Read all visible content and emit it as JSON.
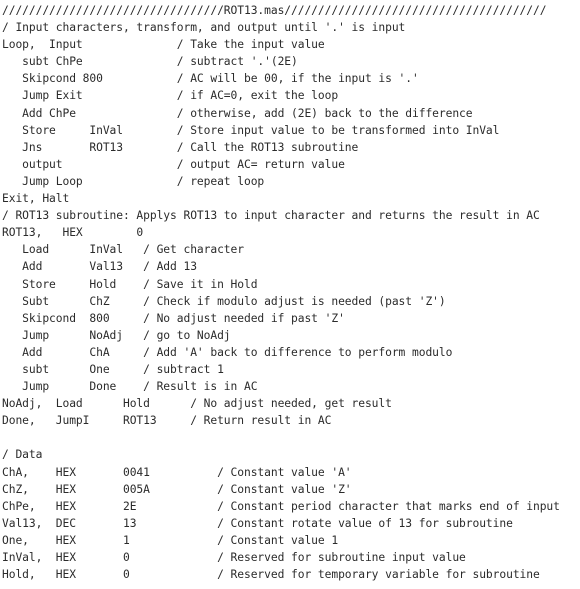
{
  "document": {
    "title": "ROT13.mas",
    "language": "MARIE Assembly",
    "background_color": "#ffffff",
    "text_color": "#2b2b2b"
  },
  "code": {
    "lines": [
      "/////////////////////////////////ROT13.mas///////////////////////////////////////",
      "/ Input characters, transform, and output until '.' is input",
      "Loop,  Input              / Take the input value",
      "   subt ChPe              / subtract '.'(2E)",
      "   Skipcond 800           / AC will be 00, if the input is '.'",
      "   Jump Exit              / if AC=0, exit the loop",
      "   Add ChPe               / otherwise, add (2E) back to the difference",
      "   Store     InVal        / Store input value to be transformed into InVal",
      "   Jns       ROT13        / Call the ROT13 subroutine",
      "   output                 / output AC= return value",
      "   Jump Loop              / repeat loop",
      "Exit, Halt",
      "/ ROT13 subroutine: Applys ROT13 to input character and returns the result in AC",
      "ROT13,   HEX        0",
      "   Load      InVal   / Get character",
      "   Add       Val13   / Add 13",
      "   Store     Hold    / Save it in Hold",
      "   Subt      ChZ     / Check if modulo adjust is needed (past 'Z')",
      "   Skipcond  800     / No adjust needed if past 'Z'",
      "   Jump      NoAdj   / go to NoAdj",
      "   Add       ChA     / Add 'A' back to difference to perform modulo",
      "   subt      One     / subtract 1",
      "   Jump      Done    / Result is in AC",
      "NoAdj,  Load      Hold      / No adjust needed, get result",
      "Done,   JumpI     ROT13     / Return result in AC",
      "",
      "/ Data",
      "ChA,    HEX       0041          / Constant value 'A'",
      "ChZ,    HEX       005A          / Constant value 'Z'",
      "ChPe,   HEX       2E            / Constant period character that marks end of input",
      "Val13,  DEC       13            / Constant rotate value of 13 for subroutine",
      "One,    HEX       1             / Constant value 1",
      "InVal,  HEX       0             / Reserved for subroutine input value",
      "Hold,   HEX       0             / Reserved for temporary variable for subroutine"
    ]
  }
}
